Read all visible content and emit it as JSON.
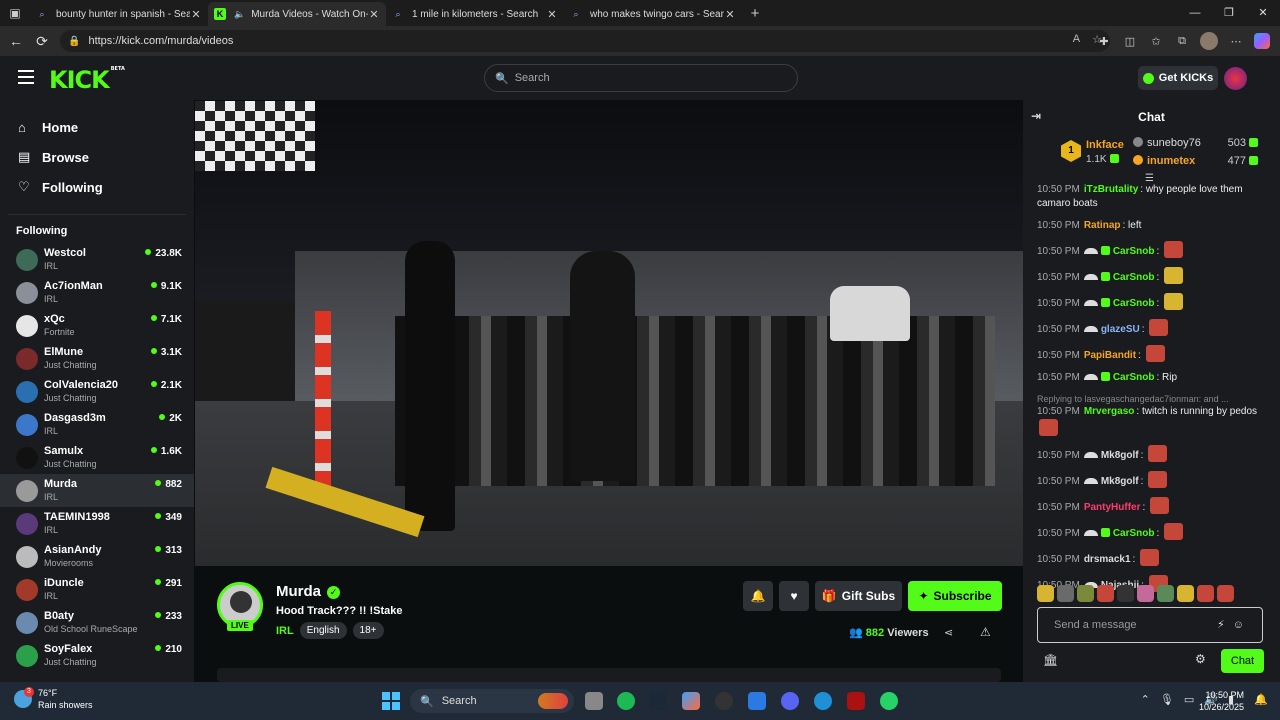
{
  "browser": {
    "tabs": [
      {
        "title": "bounty hunter in spanish - Search",
        "icon": "search-icon"
      },
      {
        "title": "Murda Videos - Watch On-D",
        "icon": "kick-icon",
        "active": true,
        "audio": true
      },
      {
        "title": "1 mile in kilometers - Search",
        "icon": "search-icon"
      },
      {
        "title": "who makes twingo cars - Search",
        "icon": "search-icon"
      }
    ],
    "new_tab": "+",
    "url": "https://kick.com/murda/videos"
  },
  "header": {
    "logo": "KICK",
    "logo_beta": "BETA",
    "search_placeholder": "Search",
    "get_kicks": "Get KICKs"
  },
  "sidebar": {
    "nav": [
      {
        "label": "Home",
        "icon": "home-icon"
      },
      {
        "label": "Browse",
        "icon": "browse-icon"
      },
      {
        "label": "Following",
        "icon": "heart-icon"
      }
    ],
    "following_title": "Following",
    "channels": [
      {
        "name": "Westcol",
        "category": "IRL",
        "viewers": "23.8K",
        "color": "#3d6b57"
      },
      {
        "name": "Ac7ionMan",
        "category": "IRL",
        "viewers": "9.1K",
        "color": "#8a8f99"
      },
      {
        "name": "xQc",
        "category": "Fortnite",
        "viewers": "7.1K",
        "color": "#e6e6e6"
      },
      {
        "name": "ElMune",
        "category": "Just Chatting",
        "viewers": "3.1K",
        "color": "#7a2a2a"
      },
      {
        "name": "ColValencia20",
        "category": "Just Chatting",
        "viewers": "2.1K",
        "color": "#2a6fb0"
      },
      {
        "name": "Dasgasd3m",
        "category": "IRL",
        "viewers": "2K",
        "color": "#3c78c9"
      },
      {
        "name": "Samulx",
        "category": "Just Chatting",
        "viewers": "1.6K",
        "color": "#111111"
      },
      {
        "name": "Murda",
        "category": "IRL",
        "viewers": "882",
        "color": "#9a9a9a",
        "selected": true
      },
      {
        "name": "TAEMIN1998",
        "category": "IRL",
        "viewers": "349",
        "color": "#5a3a7a"
      },
      {
        "name": "AsianAndy",
        "category": "Movierooms",
        "viewers": "313",
        "color": "#bbbbbb"
      },
      {
        "name": "iDuncle",
        "category": "IRL",
        "viewers": "291",
        "color": "#a23a2a"
      },
      {
        "name": "B0aty",
        "category": "Old School RuneScape",
        "viewers": "233",
        "color": "#6a8ab0"
      },
      {
        "name": "SoyFalex",
        "category": "Just Chatting",
        "viewers": "210",
        "color": "#2aa04a"
      }
    ]
  },
  "stream": {
    "streamer": "Murda",
    "live_label": "LIVE",
    "title": "Hood Track??? !! !Stake",
    "category": "IRL",
    "tags": [
      "English",
      "18+"
    ],
    "gift_label": "Gift Subs",
    "subscribe_label": "Subscribe",
    "viewers": "882",
    "viewers_label": "Viewers"
  },
  "chat": {
    "title": "Chat",
    "gifters": {
      "top": {
        "rank": "1",
        "name": "Inkface",
        "amount": "1.1K"
      },
      "second": {
        "name": "suneboy76",
        "amount": "503"
      },
      "third": {
        "name": "inumetex",
        "amount": "477"
      }
    },
    "messages": [
      {
        "time": "10:50 PM",
        "user": "iTzBrutality",
        "color": "#53fc18",
        "text": "why people love them camaro boats"
      },
      {
        "time": "10:50 PM",
        "user": "Ratinap",
        "color": "#f5a623",
        "text": "left"
      },
      {
        "time": "10:50 PM",
        "user": "CarSnob",
        "color": "#53fc18",
        "badges": true,
        "text": "",
        "emote": "#c4473a"
      },
      {
        "time": "10:50 PM",
        "user": "CarSnob",
        "color": "#53fc18",
        "badges": true,
        "text": "",
        "emote": "#d8b530"
      },
      {
        "time": "10:50 PM",
        "user": "CarSnob",
        "color": "#53fc18",
        "badges": true,
        "text": "",
        "emote": "#d8b530"
      },
      {
        "time": "10:50 PM",
        "user": "glazeSU",
        "color": "#8ab4f8",
        "hat": true,
        "text": "",
        "emote": "#c4473a"
      },
      {
        "time": "10:50 PM",
        "user": "PapiBandit",
        "color": "#f5a623",
        "text": "",
        "emote": "#c4473a"
      },
      {
        "time": "10:50 PM",
        "user": "CarSnob",
        "color": "#53fc18",
        "badges": true,
        "text": "Rip"
      },
      {
        "reply": "Replying to lasvegaschangedac7ionman: and ...",
        "time": "10:50 PM",
        "user": "Mrvergaso",
        "color": "#53fc18",
        "text": "twitch is running by pedos",
        "emote": "#c4473a"
      },
      {
        "time": "10:50 PM",
        "user": "Mk8golf",
        "color": "#dddddd",
        "hat": true,
        "text": "",
        "emote": "#c4473a"
      },
      {
        "time": "10:50 PM",
        "user": "Mk8golf",
        "color": "#dddddd",
        "hat": true,
        "text": "",
        "emote": "#c4473a"
      },
      {
        "time": "10:50 PM",
        "user": "PantyHuffer",
        "color": "#ff3c6e",
        "text": "",
        "emote": "#c4473a"
      },
      {
        "time": "10:50 PM",
        "user": "CarSnob",
        "color": "#53fc18",
        "badges": true,
        "text": "",
        "emote": "#c4473a"
      },
      {
        "time": "10:50 PM",
        "user": "drsmack1",
        "color": "#dddddd",
        "text": "",
        "emote": "#c4473a"
      },
      {
        "time": "10:50 PM",
        "user": "Najashii",
        "color": "#dddddd",
        "hat": true,
        "text": "",
        "emote": "#c4473a"
      }
    ],
    "input_placeholder": "Send a message",
    "send_label": "Chat"
  },
  "taskbar": {
    "temp": "76°F",
    "weather": "Rain showers",
    "weather_badge": "3",
    "search": "Search",
    "time": "10:50 PM",
    "date": "10/26/2025"
  }
}
